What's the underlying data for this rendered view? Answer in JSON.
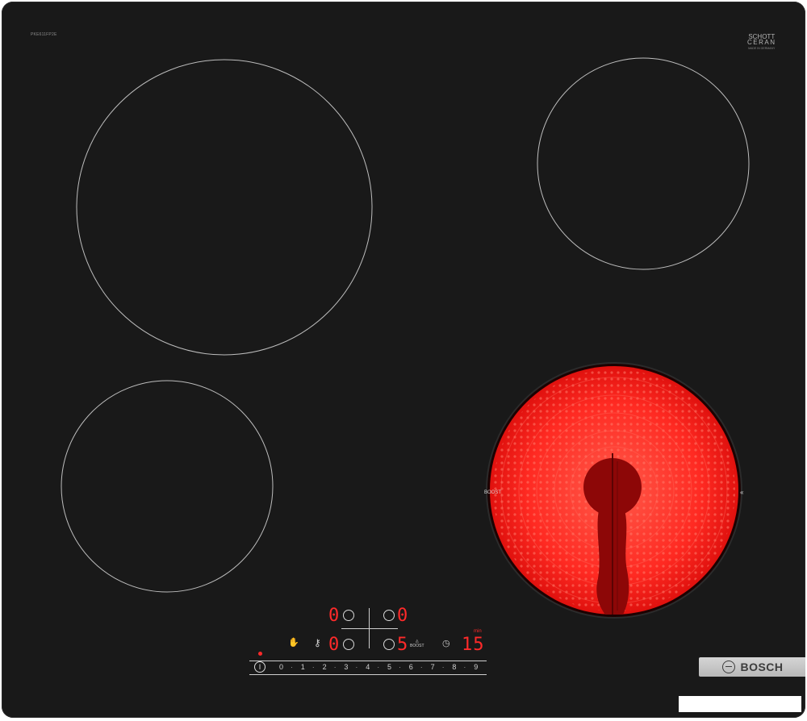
{
  "hob": {
    "model_code": "PKE611FP2E",
    "glass_brand_line1": "SCHOTT",
    "glass_brand_line2": "CERAN",
    "glass_brand_line3": "MADE IN GERMANY",
    "brand": "BOSCH"
  },
  "zones": {
    "back_left": {
      "state": "off",
      "level": "0"
    },
    "back_right": {
      "state": "off",
      "level": "0"
    },
    "front_left": {
      "state": "off",
      "level": "0"
    },
    "front_right": {
      "state": "heating",
      "level": "5",
      "glow_color": "#ff2a22"
    }
  },
  "controls": {
    "timer_value": "15",
    "timer_unit": "min",
    "boost_label": "BOOST",
    "levels": [
      "0",
      "1",
      "2",
      "3",
      "4",
      "5",
      "6",
      "7",
      "8",
      "9"
    ],
    "power_symbol": "Ⓘ",
    "icons": [
      "power-icon",
      "child-lock-icon",
      "key-icon",
      "boost-icon",
      "timer-icon",
      "bosch-logo-icon"
    ]
  },
  "colors": {
    "glass": "#191919",
    "display_red": "#ff2a2a",
    "zone_outline": "#bdbdbd"
  }
}
